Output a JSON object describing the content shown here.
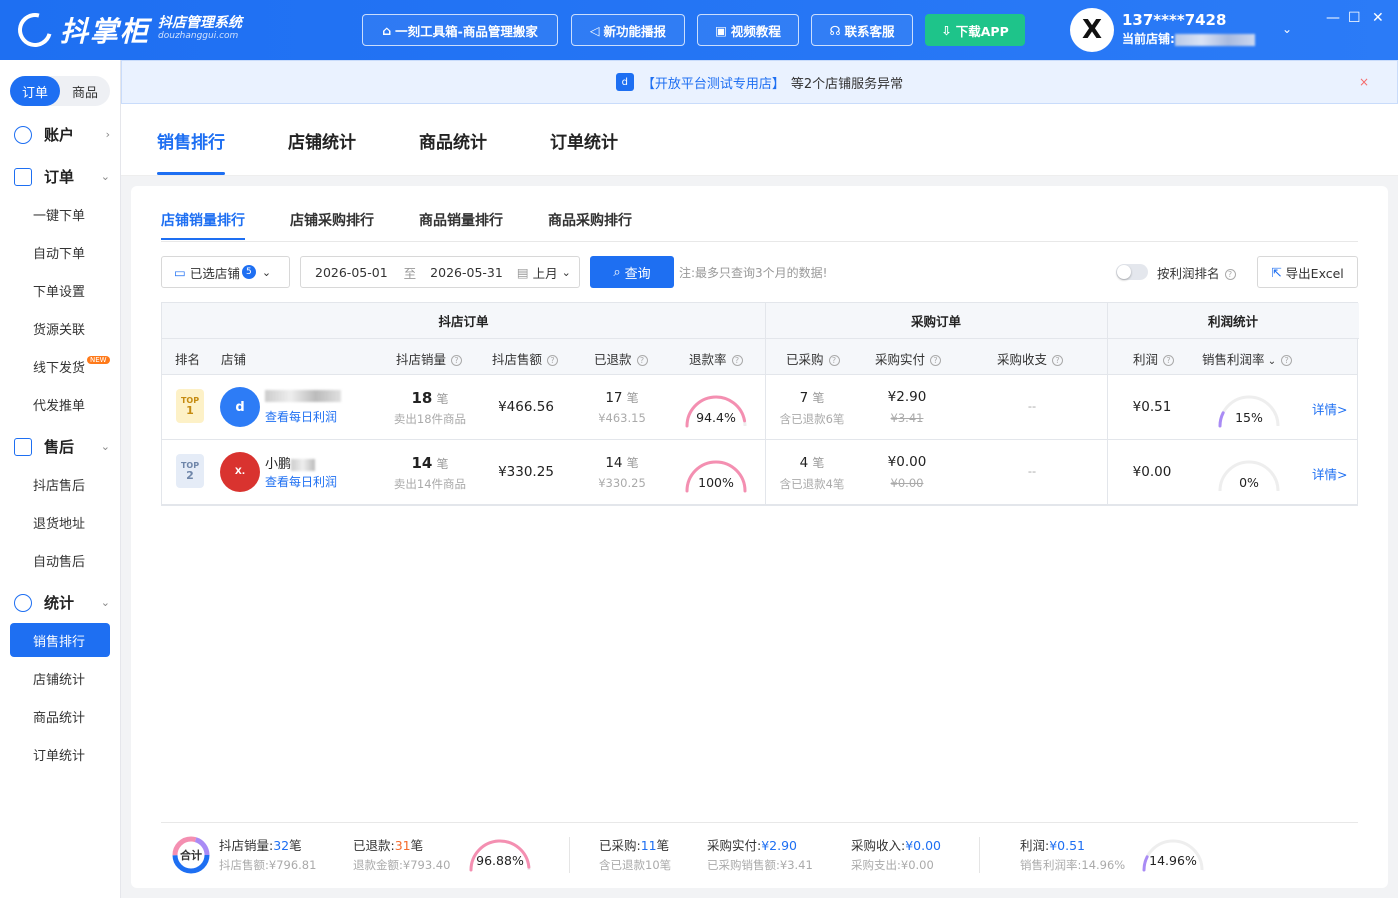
{
  "app": {
    "name": "抖掌柜",
    "subtitle": "抖店管理系统",
    "domain": "douzhanggui.com"
  },
  "topbar": {
    "buttons": [
      "一刻工具箱-商品管理搬家",
      "新功能播报",
      "视频教程",
      "联系客服",
      "下载APP"
    ],
    "user": {
      "avatar": "X",
      "phone": "137****7428",
      "shop_label": "当前店铺:"
    },
    "window": {
      "min": "—",
      "max": "☐",
      "close": "✕"
    }
  },
  "sidebar": {
    "segment": [
      "订单",
      "商品"
    ],
    "groups": [
      {
        "label": "账户",
        "icon": "smile-icon",
        "chevron": "›"
      },
      {
        "label": "订单",
        "icon": "order-list-icon",
        "chevron": "⌄",
        "items": [
          "一键下单",
          "自动下单",
          "下单设置",
          "货源关联",
          "线下发货",
          "代发推单"
        ]
      },
      {
        "label": "售后",
        "icon": "aftersale-icon",
        "chevron": "⌄",
        "items": [
          "抖店售后",
          "退货地址",
          "自动售后"
        ]
      },
      {
        "label": "统计",
        "icon": "pie-chart-icon",
        "chevron": "⌄",
        "items": [
          "销售排行",
          "店铺统计",
          "商品统计",
          "订单统计"
        ]
      }
    ],
    "new_badge": "NEW"
  },
  "notice": {
    "link": "【开放平台测试专用店】",
    "text": "等2个店铺服务异常",
    "close": "×"
  },
  "main_tabs": [
    "销售排行",
    "店铺统计",
    "商品统计",
    "订单统计"
  ],
  "sub_tabs": [
    "店铺销量排行",
    "店铺采购排行",
    "商品销量排行",
    "商品采购排行"
  ],
  "filters": {
    "shops_label": "已选店铺",
    "shops_count": "5",
    "date_start": "2026-05-01",
    "date_sep": "至",
    "date_end": "2026-05-31",
    "period": "上月",
    "query": "查询",
    "note": "注:最多只查询3个月的数据!",
    "profit_toggle": "按利润排名",
    "export": "导出Excel"
  },
  "table": {
    "groups": [
      "抖店订单",
      "采购订单",
      "利润统计"
    ],
    "headers": [
      "排名",
      "店铺",
      "抖店销量",
      "抖店售额",
      "已退款",
      "退款率",
      "已采购",
      "采购实付",
      "采购收支",
      "利润",
      "销售利润率"
    ],
    "rows": [
      {
        "rank_top": "TOP",
        "rank": "1",
        "shop_name": "",
        "shop_link": "查看每日利润",
        "sales": "18",
        "sales_unit": "笔",
        "sales_sub": "卖出18件商品",
        "amount": "¥466.56",
        "refund": "17",
        "refund_unit": "笔",
        "refund_amt": "¥463.15",
        "refund_rate": "94.4%",
        "refund_rate_value": 0.944,
        "purchased": "7",
        "purchased_unit": "笔",
        "purchased_sub": "含已退款6笔",
        "paid": "¥2.90",
        "paid_orig": "¥3.41",
        "balance": "--",
        "profit": "¥0.51",
        "margin": "15%",
        "margin_value": 0.15,
        "detail": "详情>"
      },
      {
        "rank_top": "TOP",
        "rank": "2",
        "shop_name": "小鹏",
        "shop_link": "查看每日利润",
        "sales": "14",
        "sales_unit": "笔",
        "sales_sub": "卖出14件商品",
        "amount": "¥330.25",
        "refund": "14",
        "refund_unit": "笔",
        "refund_amt": "¥330.25",
        "refund_rate": "100%",
        "refund_rate_value": 1.0,
        "purchased": "4",
        "purchased_unit": "笔",
        "purchased_sub": "含已退款4笔",
        "paid": "¥0.00",
        "paid_orig": "¥0.00",
        "balance": "--",
        "profit": "¥0.00",
        "margin": "0%",
        "margin_value": 0,
        "detail": "详情>"
      }
    ]
  },
  "footer": {
    "total": "合计",
    "sales_label": "抖店销量:",
    "sales": "32",
    "sales_unit": "笔",
    "amount_label": "抖店售额:",
    "amount": "¥796.81",
    "refund_label": "已退款:",
    "refund": "31",
    "refund_unit": "笔",
    "refund_amt_label": "退款金额:",
    "refund_amt": "¥793.40",
    "refund_rate": "96.88%",
    "refund_rate_value": 0.9688,
    "purchased_label": "已采购:",
    "purchased": "11",
    "purchased_unit": "笔",
    "purchased_sub": "含已退款10笔",
    "paid_label": "采购实付:",
    "paid": "¥2.90",
    "purchase_sales_label": "已采购销售额:",
    "purchase_sales": "¥3.41",
    "income_label": "采购收入:",
    "income": "¥0.00",
    "expense_label": "采购支出:",
    "expense": "¥0.00",
    "profit_label": "利润:",
    "profit": "¥0.51",
    "margin_label": "销售利润率:",
    "margin": "14.96%",
    "margin_value": 0.1496
  },
  "colors": {
    "accent": "#1e6ff2",
    "download": "#1ec48a",
    "refund_gauge": "#f48fb1",
    "profit_gauge": "#a98bf5"
  }
}
